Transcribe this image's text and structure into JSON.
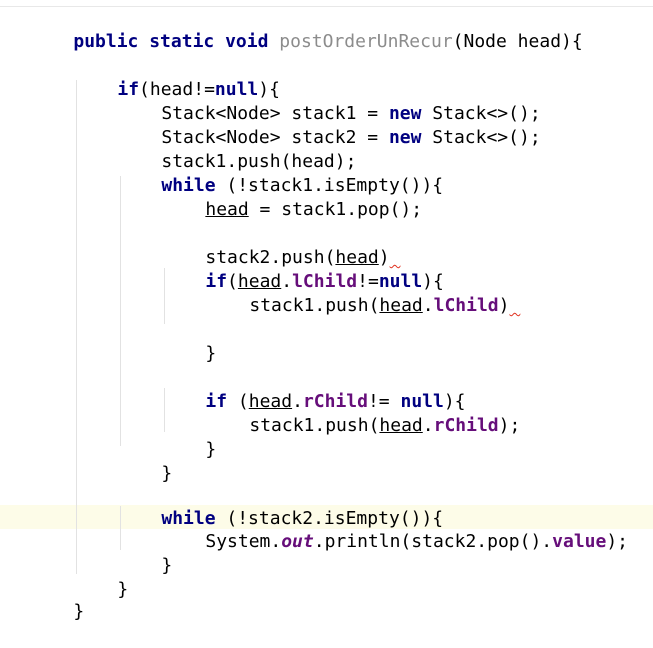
{
  "editor": {
    "background": "#ffffff",
    "current_line_color": "#fdfce8",
    "colors": {
      "keyword": "#000080",
      "unused_method": "#8c8c8c",
      "field": "#660e7a",
      "warning_squiggle": "#e0301e"
    }
  },
  "code": {
    "l1": {
      "kw1": "public static void ",
      "name": "postOrderUnRecur",
      "rest": "(Node head){"
    },
    "l2": {
      "kw": "if",
      "a": "(head!=",
      "b": "null",
      "c": "){"
    },
    "l3": {
      "a": "Stack<Node> stack1 = ",
      "kw": "new",
      "b": " Stack<>();"
    },
    "l4": {
      "a": "Stack<Node> stack2 = ",
      "kw": "new",
      "b": " Stack<>();"
    },
    "l5": {
      "a": "stack1.push(head);"
    },
    "l6": {
      "kw": "while",
      "a": " (!stack1.isEmpty()){"
    },
    "l7": {
      "head": "head",
      "a": " = stack1.pop();"
    },
    "l8": {
      "a": "stack2.push(",
      "head": "head",
      "b": ")",
      "warn": " "
    },
    "l9": {
      "kw": "if",
      "a": "(",
      "head": "head",
      "dot": ".",
      "field": "lChild",
      "b": "!=",
      "kw2": "null",
      "c": "){"
    },
    "l10": {
      "a": "stack1.push(",
      "head": "head",
      "dot": ".",
      "field": "lChild",
      "b": ")",
      "warn": " "
    },
    "l11": {
      "a": "}"
    },
    "l12": {
      "kw": "if",
      "a": " (",
      "head": "head",
      "dot": ".",
      "field": "rChild",
      "b": "!= ",
      "kw2": "null",
      "c": "){"
    },
    "l13": {
      "a": "stack1.push(",
      "head": "head",
      "dot": ".",
      "field": "rChild",
      "b": ");"
    },
    "l14": {
      "a": "}"
    },
    "l15": {
      "a": "}"
    },
    "l16": {
      "kw": "while",
      "a": " (!stack2.isEmpty()){"
    },
    "l17": {
      "a": "System.",
      "out": "out",
      "b": ".println(stack2.pop().",
      "field": "value",
      "c": ");"
    },
    "l18": {
      "a": "}"
    },
    "l19": {
      "a": "}"
    },
    "l20": {
      "a": "}"
    }
  }
}
